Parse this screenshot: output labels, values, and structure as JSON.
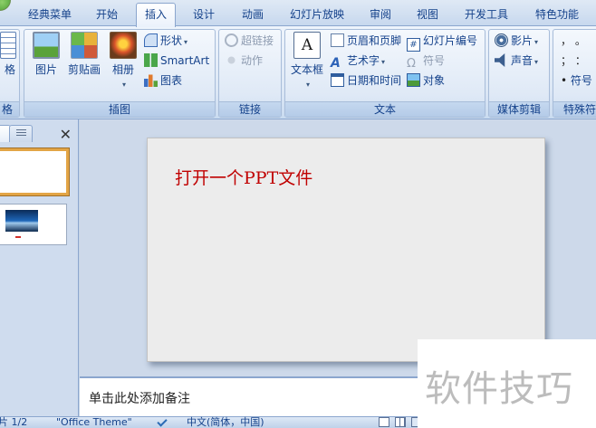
{
  "tabs": [
    "经典菜单",
    "开始",
    "插入",
    "设计",
    "动画",
    "幻灯片放映",
    "审阅",
    "视图",
    "开发工具",
    "特色功能"
  ],
  "active_tab": "插入",
  "ribbon": {
    "table_group": {
      "button_label": "格",
      "group_label": "格"
    },
    "illustrations": {
      "group_label": "插图",
      "picture": "图片",
      "clipart": "剪贴画",
      "album": "相册",
      "shapes": "形状",
      "smartart": "SmartArt",
      "chart": "图表"
    },
    "links": {
      "group_label": "链接",
      "hyperlink": "超链接",
      "action": "动作"
    },
    "text": {
      "group_label": "文本",
      "textbox": "文本框",
      "header_footer": "页眉和页脚",
      "wordart": "艺术字",
      "datetime": "日期和时间",
      "slide_number": "幻灯片编号",
      "symbol": "符号",
      "object": "对象"
    },
    "media": {
      "group_label": "媒体剪辑",
      "movie": "影片",
      "sound": "声音"
    },
    "special": {
      "group_label": "特殊符",
      "row1": "，  。",
      "row2": "；  ：",
      "symbol": "符号"
    }
  },
  "slide": {
    "title": "打开一个PPT文件"
  },
  "notes_placeholder": "单击此处添加备注",
  "status": {
    "slide_counter": "片 1/2",
    "theme": "\"Office Theme\"",
    "language": "中文(简体，中国)"
  },
  "watermark": "软件技巧",
  "colors": {
    "slide_title": "#c00000",
    "ribbon_text": "#15428b",
    "selected_thumb": "#e3a546"
  }
}
